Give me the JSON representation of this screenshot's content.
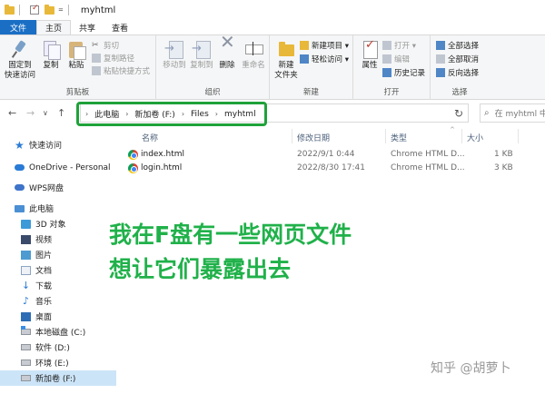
{
  "window": {
    "title": "myhtml",
    "qa_dropdown": "="
  },
  "ribbon_tabs": [
    "文件",
    "主页",
    "共享",
    "查看"
  ],
  "ribbon": {
    "clipboard": {
      "label": "剪贴板",
      "pin": "固定到\n快速访问",
      "copy": "复制",
      "paste": "粘贴",
      "cut": "剪切",
      "copy_path": "复制路径",
      "paste_shortcut": "粘贴快捷方式"
    },
    "organize": {
      "label": "组织",
      "move_to": "移动到",
      "copy_to": "复制到",
      "delete": "删除",
      "rename": "重命名"
    },
    "new": {
      "label": "新建",
      "new_folder": "新建\n文件夹",
      "new_item": "新建项目 ▾",
      "easy_access": "轻松访问 ▾"
    },
    "open": {
      "label": "打开",
      "properties": "属性",
      "open": "打开 ▾",
      "edit": "编辑",
      "history": "历史记录"
    },
    "select": {
      "label": "选择",
      "select_all": "全部选择",
      "select_none": "全部取消",
      "invert": "反向选择"
    }
  },
  "nav": {
    "back": "←",
    "forward": "→",
    "recent": "∨",
    "up": "↑",
    "breadcrumb": [
      "此电脑",
      "新加卷 (F:)",
      "Files",
      "myhtml"
    ],
    "breadcrumb_chevron": "›",
    "refresh": "↻",
    "search_placeholder": "在 myhtml 中"
  },
  "sidebar": [
    {
      "label": "快速访问",
      "icon": "star-icon"
    },
    {
      "label": "OneDrive - Personal",
      "icon": "cloud-icon"
    },
    {
      "label": "WPS网盘",
      "icon": "wps-cloud-icon"
    },
    {
      "label": "此电脑",
      "icon": "computer-icon"
    },
    {
      "label": "3D 对象",
      "icon": "3d-objects-icon"
    },
    {
      "label": "视频",
      "icon": "video-icon"
    },
    {
      "label": "图片",
      "icon": "pictures-icon"
    },
    {
      "label": "文档",
      "icon": "documents-icon"
    },
    {
      "label": "下载",
      "icon": "download-icon"
    },
    {
      "label": "音乐",
      "icon": "music-icon"
    },
    {
      "label": "桌面",
      "icon": "desktop-icon"
    },
    {
      "label": "本地磁盘 (C:)",
      "icon": "drive-icon"
    },
    {
      "label": "软件 (D:)",
      "icon": "drive-icon"
    },
    {
      "label": "环境 (E:)",
      "icon": "drive-icon"
    },
    {
      "label": "新加卷 (F:)",
      "icon": "drive-icon"
    }
  ],
  "file_list": {
    "columns": [
      "名称",
      "修改日期",
      "类型",
      "大小"
    ],
    "rows": [
      {
        "name": "index.html",
        "modified": "2022/9/1 0:44",
        "type": "Chrome HTML D...",
        "size": "1 KB"
      },
      {
        "name": "login.html",
        "modified": "2022/8/30 17:41",
        "type": "Chrome HTML D...",
        "size": "3 KB"
      }
    ]
  },
  "annotation": {
    "line1": "我在F盘有一些网页文件",
    "line2": "想让它们暴露出去",
    "color": "#20b14a"
  },
  "watermark": "知乎 @胡萝卜",
  "colors": {
    "file_tab": "#1a6fc5",
    "highlight_outline": "#1fa23a",
    "selected_nav": "#cce4f7"
  }
}
